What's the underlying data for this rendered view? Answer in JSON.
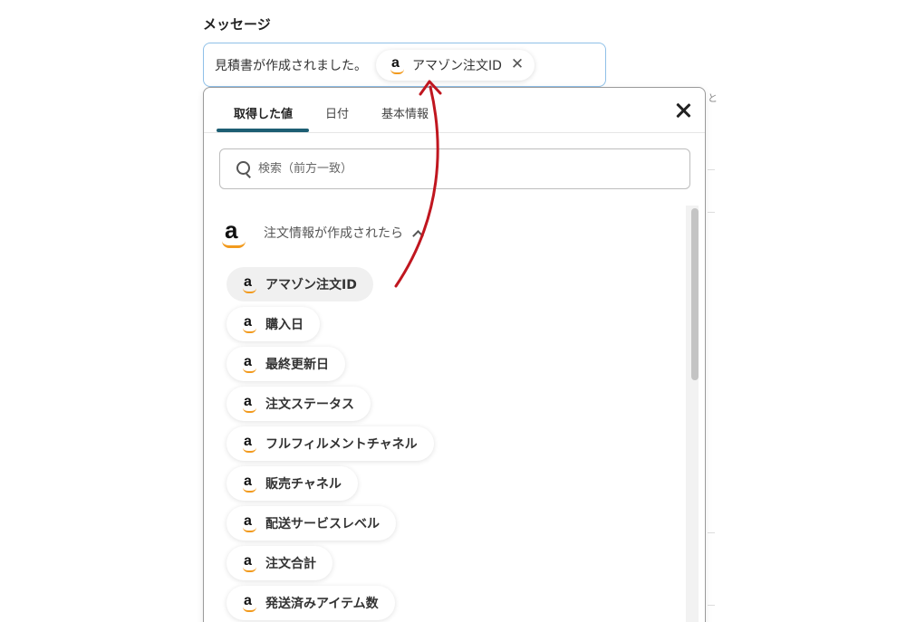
{
  "message": {
    "label": "メッセージ",
    "text": "見積書が作成されました。",
    "token_label": "アマゾン注文ID",
    "token_close": "✕"
  },
  "side": {
    "char": "と"
  },
  "panel": {
    "tabs": [
      {
        "label": "取得した値",
        "active": true
      },
      {
        "label": "日付",
        "active": false
      },
      {
        "label": "基本情報",
        "active": false
      }
    ],
    "search_placeholder": "検索（前方一致）",
    "group_label": "注文情報が作成されたら",
    "items": [
      {
        "label": "アマゾン注文ID",
        "highlighted": true
      },
      {
        "label": "購入日"
      },
      {
        "label": "最終更新日"
      },
      {
        "label": "注文ステータス"
      },
      {
        "label": "フルフィルメントチャネル"
      },
      {
        "label": "販売チャネル"
      },
      {
        "label": "配送サービスレベル"
      },
      {
        "label": "注文合計"
      },
      {
        "label": "発送済みアイテム数"
      }
    ]
  },
  "colors": {
    "accent": "#1d5e73",
    "field_border": "#8fc0e8",
    "arrow": "#c0161f",
    "amazon_smile": "#f29a1d"
  }
}
